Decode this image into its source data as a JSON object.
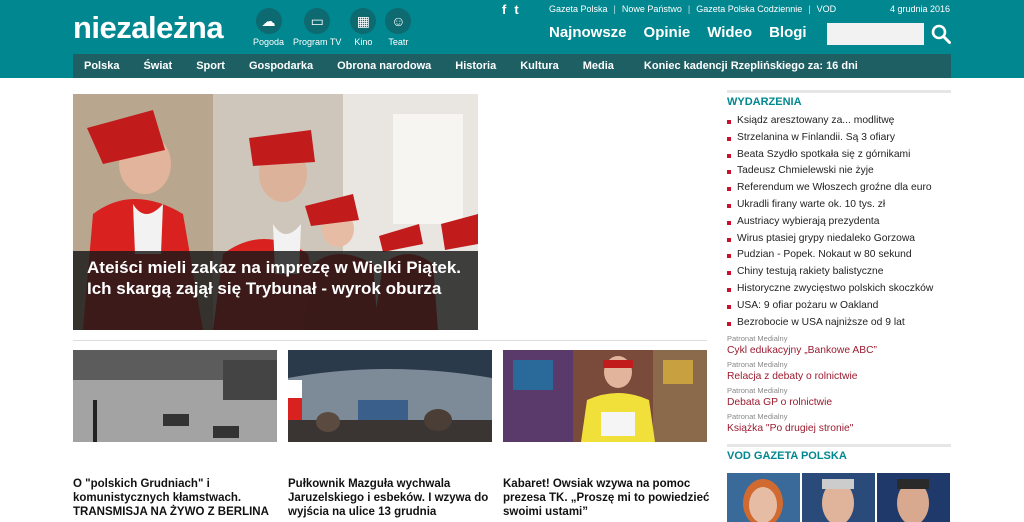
{
  "header": {
    "logo": "niezależna",
    "icons": [
      {
        "label": "Pogoda",
        "icon": "weather-icon",
        "glyph": "☁"
      },
      {
        "label": "Program TV",
        "icon": "tv-icon",
        "glyph": "▭"
      },
      {
        "label": "Kino",
        "icon": "film-icon",
        "glyph": "▦"
      },
      {
        "label": "Teatr",
        "icon": "theater-masks-icon",
        "glyph": "☺"
      }
    ],
    "social": {
      "facebook": "f",
      "twitter": "t"
    },
    "pub_links": [
      "Gazeta Polska",
      "Nowe Państwo",
      "Gazeta Polska Codziennie",
      "VOD"
    ],
    "date": "4 grudnia 2016",
    "main_nav": [
      "Najnowsze",
      "Opinie",
      "Wideo",
      "Blogi"
    ],
    "search": {
      "placeholder": ""
    }
  },
  "categories": [
    "Polska",
    "Świat",
    "Sport",
    "Gospodarka",
    "Obrona narodowa",
    "Historia",
    "Kultura",
    "Media"
  ],
  "ticker": "Koniec kadencji Rzeplińskiego za: 16 dni",
  "hero": {
    "title": "Ateiści mieli zakaz na imprezę w Wielki Piątek. Ich skargą zajął się Trybunał - wyrok oburza"
  },
  "articles": [
    {
      "title": "O \"polskich Grudniach\" i komunistycznych kłamstwach. TRANSMISJA NA ŻYWO Z BERLINA"
    },
    {
      "title": "Pułkownik Mazguła wychwala Jaruzelskiego i esbeków. I wzywa do wyjścia na ulice 13 grudnia"
    },
    {
      "title": "Kabaret! Owsiak wzywa na pomoc prezesa TK. „Proszę mi to powiedzieć swoimi ustami”"
    }
  ],
  "sidebar": {
    "heading": "WYDARZENIA",
    "events": [
      "Ksiądz aresztowany za... modlitwę",
      "Strzelanina w Finlandii. Są 3 ofiary",
      "Beata Szydło spotkała się z górnikami",
      "Tadeusz Chmielewski nie żyje",
      "Referendum we Włoszech groźne dla euro",
      "Ukradli firany warte ok. 10 tys. zł",
      "Austriacy wybierają prezydenta",
      "Wirus ptasiej grypy niedaleko Gorzowa",
      "Pudzian - Popek. Nokaut w 80 sekund",
      "Chiny testują rakiety balistyczne",
      "Historyczne zwycięstwo polskich skoczków",
      "USA: 9 ofiar pożaru w Oakland",
      "Bezrobocie w USA najniższe od 9 lat"
    ],
    "patronage": [
      {
        "label": "Patronat Medialny",
        "title": "Cykl edukacyjny „Bankowe ABC”"
      },
      {
        "label": "Patronat Medialny",
        "title": "Relacja z debaty o rolnictwie"
      },
      {
        "label": "Patronat Medialny",
        "title": "Debata GP o rolnictwie"
      },
      {
        "label": "Patronat Medialny",
        "title": "Książka \"Po drugiej stronie\""
      }
    ],
    "vod_heading": "VOD GAZETA POLSKA"
  },
  "colors": {
    "brand": "#00878f",
    "nav_dark": "#1e5f63",
    "accent_red": "#c8102e",
    "patron_link": "#9b1b30"
  }
}
